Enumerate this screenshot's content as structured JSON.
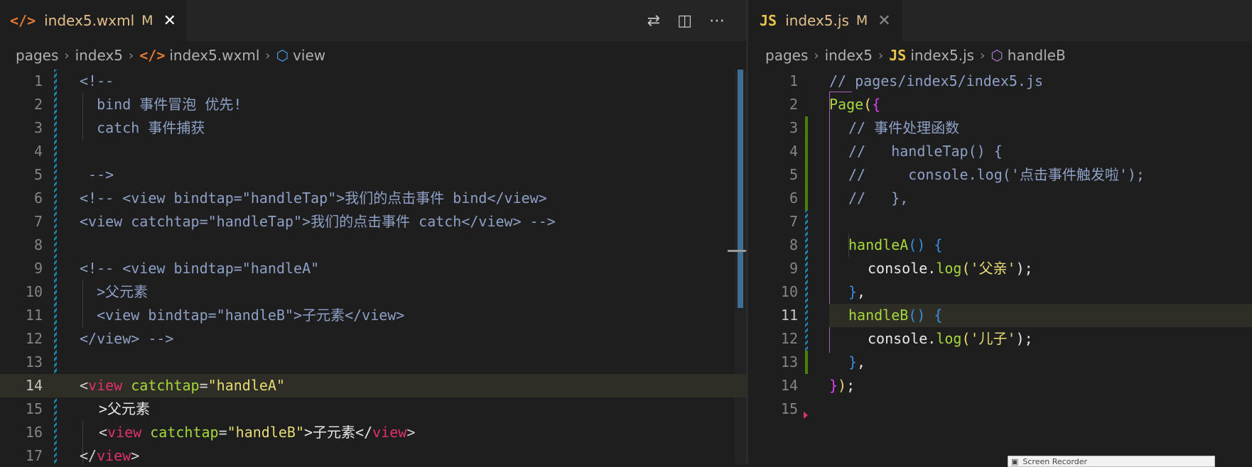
{
  "left_editor": {
    "tab": {
      "icon": "</>",
      "title": "index5.wxml",
      "modified": "M",
      "close": "✕"
    },
    "actions": [
      "⇄",
      "◫",
      "⋯"
    ],
    "breadcrumb": [
      "pages",
      "index5",
      "index5.wxml",
      "view"
    ],
    "lines": [
      "1",
      "2",
      "3",
      "4",
      "5",
      "6",
      "7",
      "8",
      "9",
      "10",
      "11",
      "12",
      "13",
      "14",
      "15",
      "16",
      "17"
    ],
    "code": {
      "l1": "<!--",
      "l2": "  bind 事件冒泡 优先!",
      "l3": "  catch 事件捕获",
      "l5": " -->",
      "l6": "<!-- <view bindtap=\"handleTap\">我们的点击事件 bind</view>",
      "l7": "<view catchtap=\"handleTap\">我们的点击事件 catch</view> -->",
      "l9": "<!-- <view bindtap=\"handleA\"",
      "l10": "  >父元素",
      "l11": "  <view bindtap=\"handleB\">子元素</view>",
      "l12": "</view> -->",
      "l14_open": "<",
      "l14_tag": "view",
      "l14_attr": "catchtap",
      "l14_eq": "=",
      "l14_str": "\"handleA\"",
      "l15": ">父元素",
      "l16_open": "<",
      "l16_tag": "view",
      "l16_attr": "catchtap",
      "l16_eq": "=",
      "l16_str": "\"handleB\"",
      "l16_txt": ">子元素</",
      "l16_tag2": "view",
      "l16_close": ">",
      "l17_open": "</",
      "l17_tag": "view",
      "l17_close": ">"
    }
  },
  "right_editor": {
    "tab": {
      "icon": "JS",
      "title": "index5.js",
      "modified": "M",
      "close": "✕"
    },
    "breadcrumb": [
      "pages",
      "index5",
      "index5.js",
      "handleB"
    ],
    "lines": [
      "1",
      "2",
      "3",
      "4",
      "5",
      "6",
      "7",
      "8",
      "9",
      "10",
      "11",
      "12",
      "13",
      "14",
      "15"
    ],
    "code": {
      "l1": "// pages/index5/index5.js",
      "l2_fn": "Page",
      "l2_p": "(",
      "l2_b": "{",
      "l3": "// 事件处理函数",
      "l4": "//   handleTap() {",
      "l5": "//     console.log('点击事件触发啦');",
      "l6": "//   },",
      "l8_fn": "handleA",
      "l8_p": "() {",
      "l9_a": "console.",
      "l9_fn": "log",
      "l9_p1": "(",
      "l9_str": "'父亲'",
      "l9_p2": ");",
      "l10_b": "}",
      "l10_c": ",",
      "l11_fn": "handleB",
      "l11_p": "() {",
      "l12_a": "console.",
      "l12_fn": "log",
      "l12_p1": "(",
      "l12_str": "'儿子'",
      "l12_p2": ");",
      "l13_b": "}",
      "l13_c": ",",
      "l14_b": "}",
      "l14_p": ")",
      "l14_s": ";"
    }
  },
  "recorder": {
    "title": "Screen Recorder"
  },
  "colors": {
    "bg": "#1e1e1e",
    "tag": "#e0306c",
    "attr": "#a6d83e",
    "string": "#e6db74",
    "comment": "#8ea0c6",
    "modified": "#e2c08d"
  }
}
